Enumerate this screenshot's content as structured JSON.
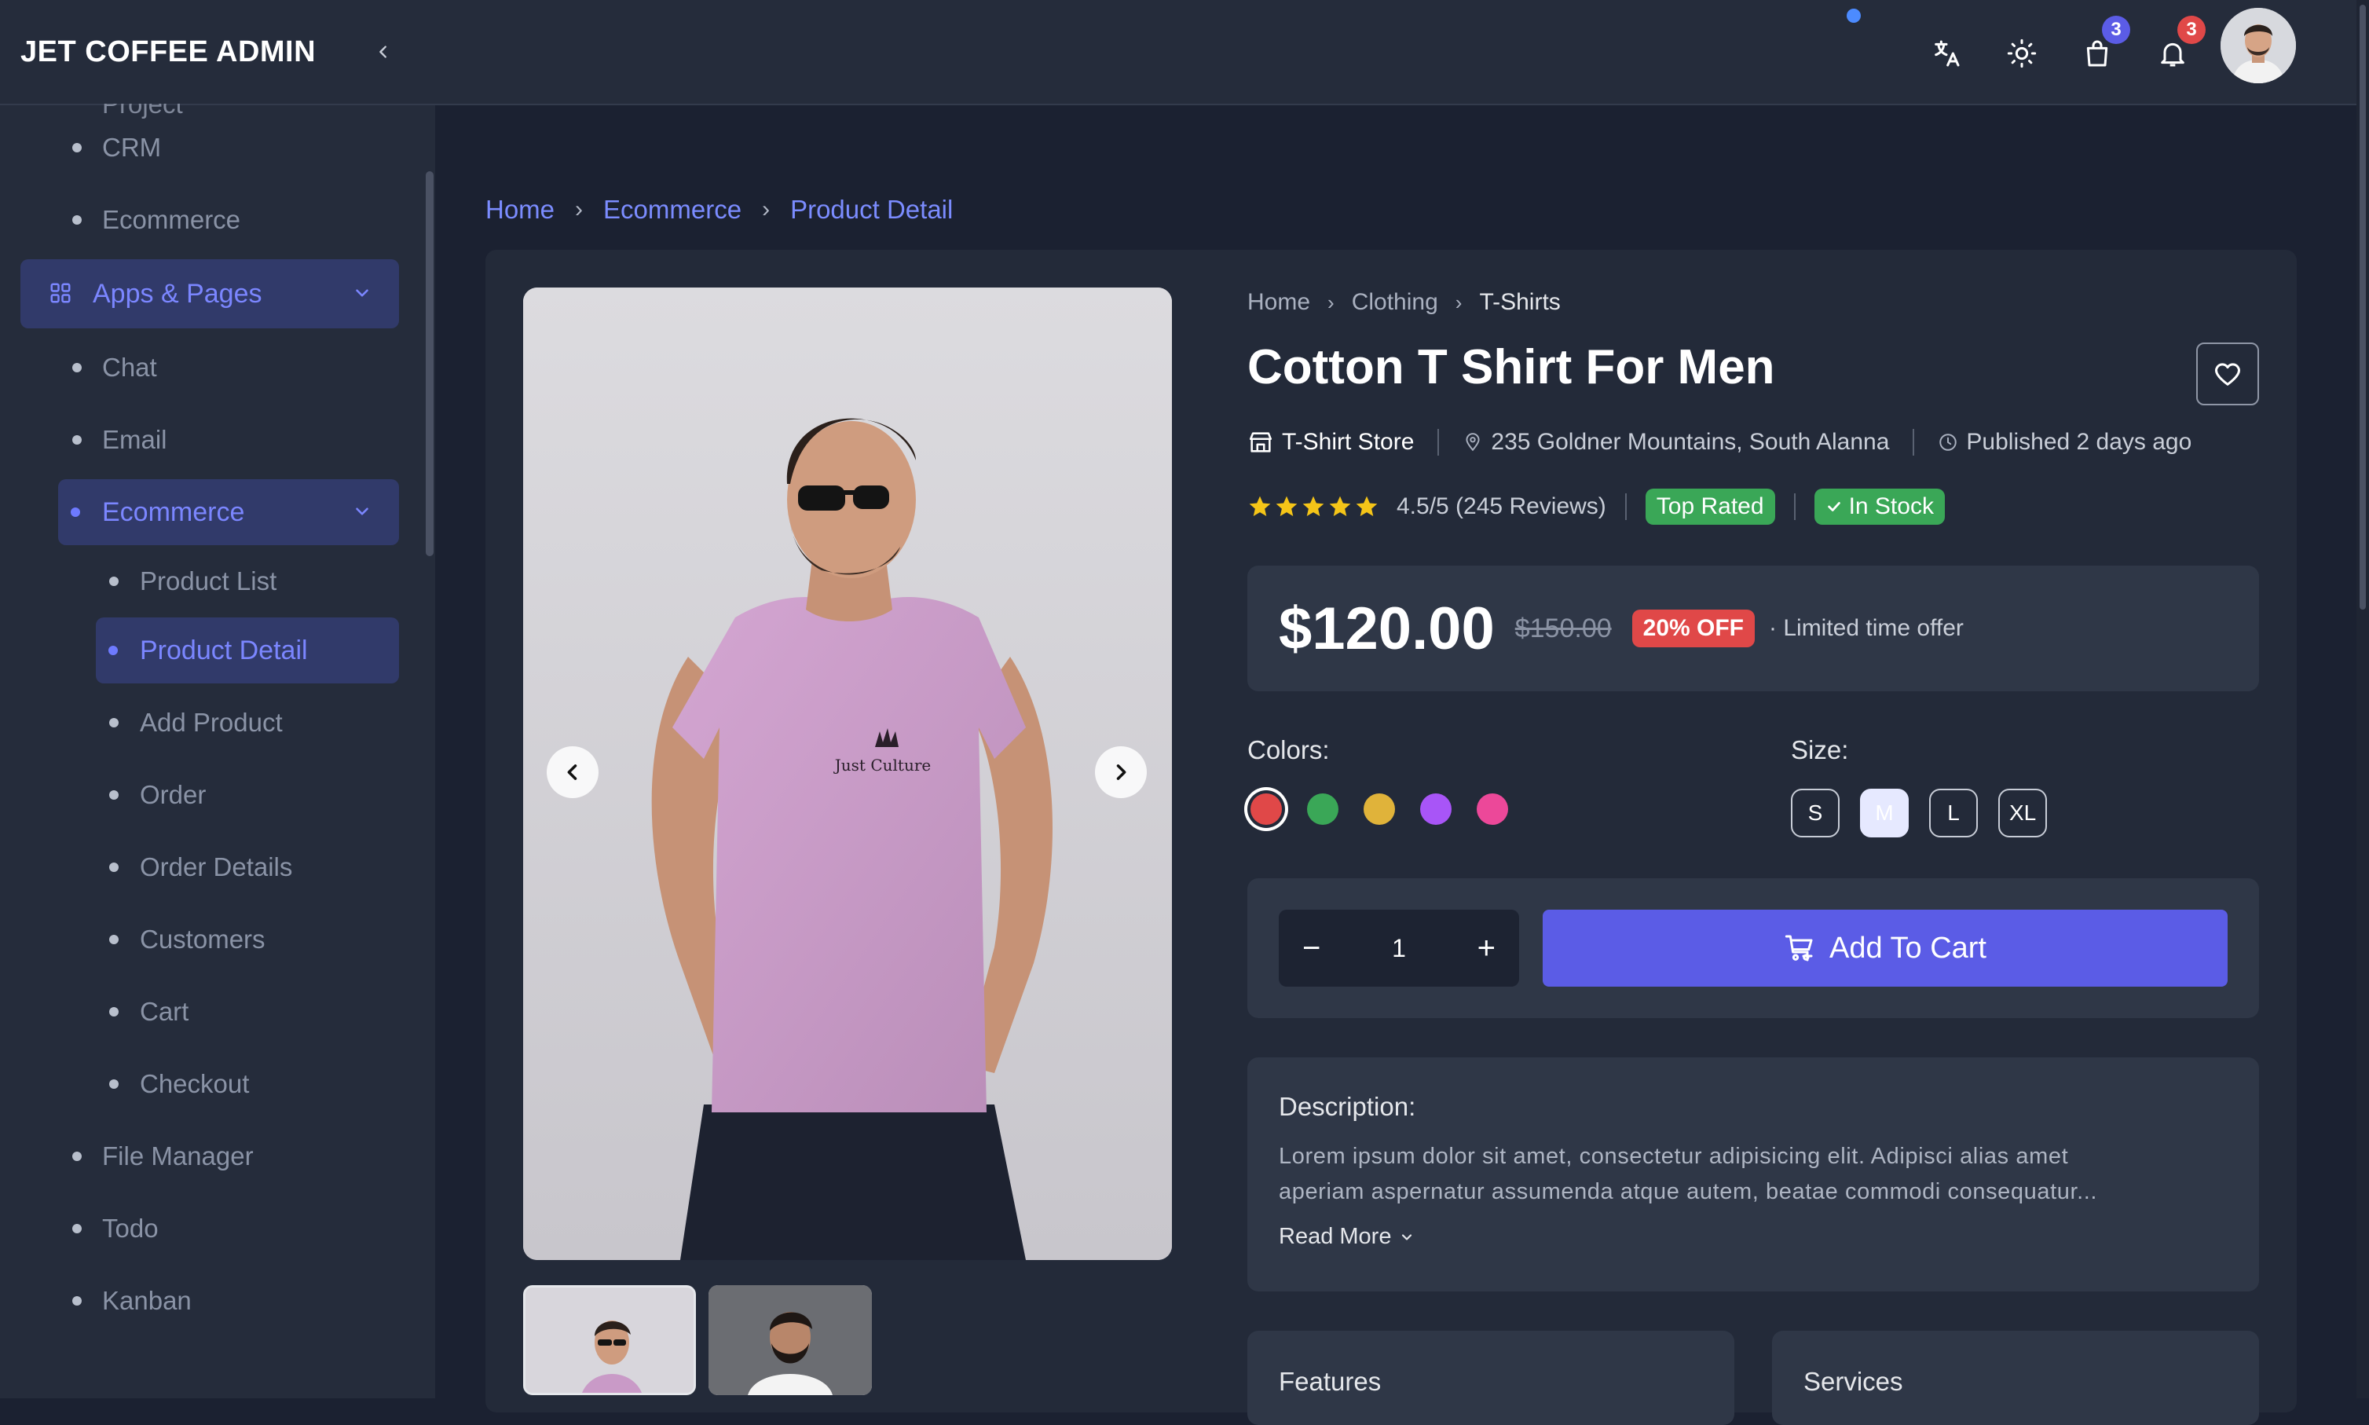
{
  "app": {
    "title": "JET COFFEE ADMIN"
  },
  "sidebar": {
    "cut_item": "Project",
    "items_before": [
      "CRM",
      "Ecommerce"
    ],
    "group": "Apps & Pages",
    "items_mid": [
      "Chat",
      "Email"
    ],
    "sub_group": "Ecommerce",
    "sub_items": [
      "Product List",
      "Product Detail",
      "Add Product",
      "Order",
      "Order Details",
      "Customers",
      "Cart",
      "Checkout"
    ],
    "items_after": [
      "File Manager",
      "Todo",
      "Kanban"
    ]
  },
  "topbar": {
    "cart_count": "3",
    "notif_count": "3",
    "icons": [
      "translate-icon",
      "sun-icon",
      "shopping-bag-icon",
      "bell-icon"
    ]
  },
  "breadcrumb": [
    "Home",
    "Ecommerce",
    "Product Detail"
  ],
  "product": {
    "crumbs": [
      "Home",
      "Clothing",
      "T-Shirts"
    ],
    "title": "Cotton T Shirt For Men",
    "store": "T-Shirt Store",
    "location": "235 Goldner Mountains, South Alanna",
    "published": "Published 2 days ago",
    "stars": 5,
    "rating_text": "4.5/5 (245 Reviews)",
    "top_rated": "Top Rated",
    "in_stock": "In Stock",
    "price": "$120.00",
    "old_price": "$150.00",
    "discount": "20% OFF",
    "offer": "· Limited time offer",
    "colors_label": "Colors:",
    "colors": [
      "#e04848",
      "#3aa757",
      "#e0b33a",
      "#a855f7",
      "#ec4899"
    ],
    "selected_color": 0,
    "size_label": "Size:",
    "sizes": [
      "S",
      "M",
      "L",
      "XL"
    ],
    "selected_size": "M",
    "quantity": "1",
    "qty_minus": "−",
    "qty_plus": "+",
    "add_to_cart": "Add To Cart",
    "description_title": "Description:",
    "description_line1": "Lorem ipsum dolor sit amet, consectetur adipisicing elit. Adipisci alias amet",
    "description_line2": "aperiam aspernatur assumenda atque autem, beatae commodi consequatur...",
    "read_more": "Read More",
    "features_title": "Features",
    "services_title": "Services"
  },
  "colors": {
    "accent": "#5b5ce6",
    "success": "#3aa757",
    "danger": "#e04848"
  }
}
